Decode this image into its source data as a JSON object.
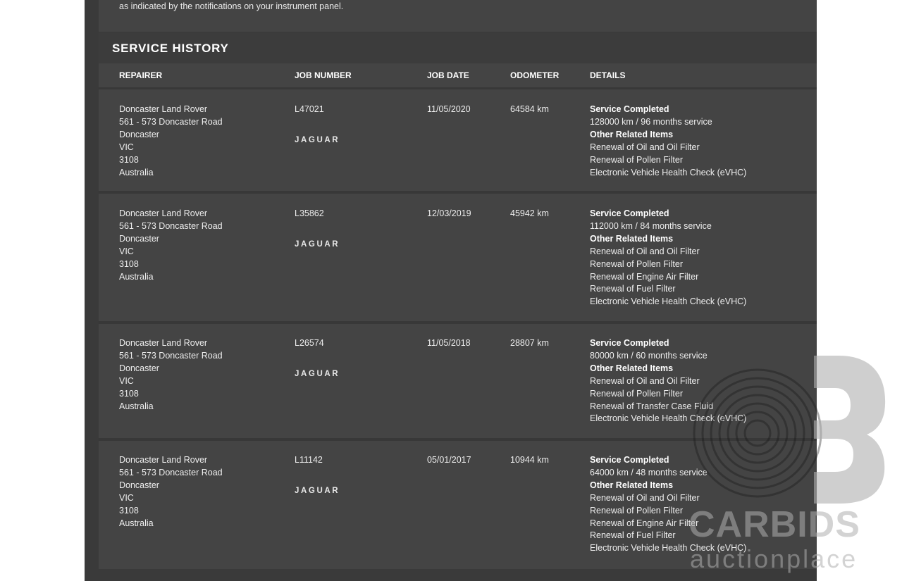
{
  "intro_text": "as indicated by the notifications on your instrument panel.",
  "section_title": "SERVICE HISTORY",
  "columns": {
    "repairer": "REPAIRER",
    "job_number": "JOB NUMBER",
    "job_date": "JOB DATE",
    "odometer": "ODOMETER",
    "details": "DETAILS"
  },
  "records": [
    {
      "address": [
        "Doncaster Land Rover",
        "561 - 573 Doncaster Road",
        "Doncaster",
        "VIC",
        "3108",
        "Australia"
      ],
      "job_number": "L47021",
      "brand": "JAGUAR",
      "job_date": "11/05/2020",
      "odometer": "64584 km",
      "service_label": "Service Completed",
      "service": "128000 km / 96 months service",
      "related_label": "Other Related Items",
      "items": [
        "Renewal of Oil and Oil Filter",
        "Renewal of Pollen Filter",
        "Electronic Vehicle Health Check (eVHC)"
      ]
    },
    {
      "address": [
        "Doncaster Land Rover",
        "561 - 573 Doncaster Road",
        "Doncaster",
        "VIC",
        "3108",
        "Australia"
      ],
      "job_number": "L35862",
      "brand": "JAGUAR",
      "job_date": "12/03/2019",
      "odometer": "45942 km",
      "service_label": "Service Completed",
      "service": "112000 km / 84 months service",
      "related_label": "Other Related Items",
      "items": [
        "Renewal of Oil and Oil Filter",
        "Renewal of Pollen Filter",
        "Renewal of Engine Air Filter",
        "Renewal of Fuel Filter",
        "Electronic Vehicle Health Check (eVHC)"
      ]
    },
    {
      "address": [
        "Doncaster Land Rover",
        "561 - 573 Doncaster Road",
        "Doncaster",
        "VIC",
        "3108",
        "Australia"
      ],
      "job_number": "L26574",
      "brand": "JAGUAR",
      "job_date": "11/05/2018",
      "odometer": "28807 km",
      "service_label": "Service Completed",
      "service": "80000 km / 60 months service",
      "related_label": "Other Related Items",
      "items": [
        "Renewal of Oil and Oil Filter",
        "Renewal of Pollen Filter",
        "Renewal of Transfer Case Fluid",
        "Electronic Vehicle Health Check (eVHC)"
      ]
    },
    {
      "address": [
        "Doncaster Land Rover",
        "561 - 573 Doncaster Road",
        "Doncaster",
        "VIC",
        "3108",
        "Australia"
      ],
      "job_number": "L11142",
      "brand": "JAGUAR",
      "job_date": "05/01/2017",
      "odometer": "10944 km",
      "service_label": "Service Completed",
      "service": "64000 km / 48 months service",
      "related_label": "Other Related Items",
      "items": [
        "Renewal of Oil and Oil Filter",
        "Renewal of Pollen Filter",
        "Renewal of Engine Air Filter",
        "Renewal of Fuel Filter",
        "Electronic Vehicle Health Check (eVHC)"
      ]
    }
  ],
  "watermark": {
    "logo_icon": "fingerprint-b-logo-icon",
    "line1": "CARBIDS",
    "line2": "auctionplace"
  }
}
